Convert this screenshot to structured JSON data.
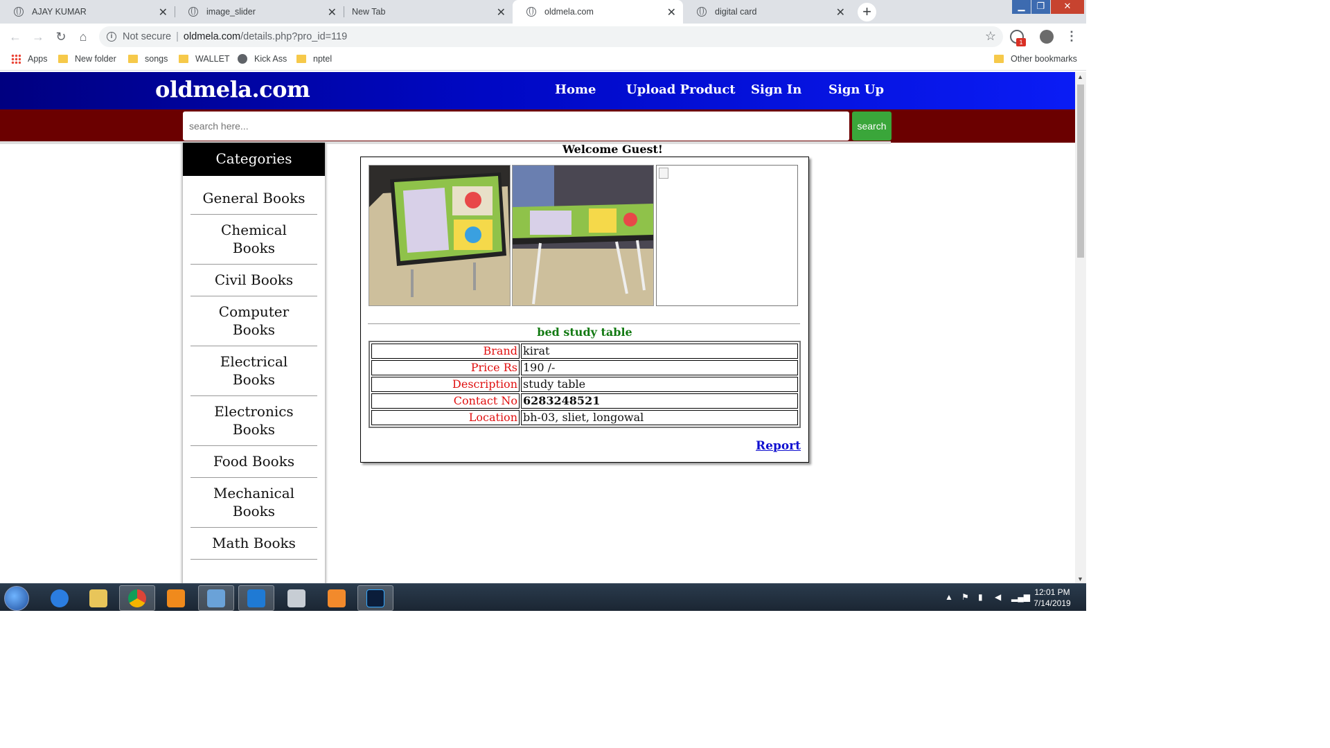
{
  "browser": {
    "tabs": [
      {
        "label": "AJAY KUMAR",
        "active": false
      },
      {
        "label": "image_slider",
        "active": false
      },
      {
        "label": "New Tab",
        "active": false
      },
      {
        "label": "oldmela.com",
        "active": true
      },
      {
        "label": "digital card",
        "active": false
      }
    ],
    "address": {
      "security_label": "Not secure",
      "host": "oldmela.com",
      "path": "/details.php?pro_id=119"
    },
    "extension_badge": "1",
    "bookmarks": [
      {
        "label": "Apps",
        "icon": "apps-grid-icon"
      },
      {
        "label": "New folder",
        "icon": "folder-icon"
      },
      {
        "label": "songs",
        "icon": "folder-icon"
      },
      {
        "label": "WALLET",
        "icon": "folder-icon"
      },
      {
        "label": "Kick Ass",
        "icon": "globe-icon"
      },
      {
        "label": "nptel",
        "icon": "folder-icon"
      }
    ],
    "other_bookmarks": "Other bookmarks"
  },
  "site": {
    "brand": "oldmela.com",
    "nav": [
      "Home",
      "Upload Product",
      "Sign In",
      "Sign Up"
    ],
    "search": {
      "placeholder": "search here...",
      "button": "search"
    },
    "sidebar": {
      "title": "Categories",
      "items": [
        "General Books",
        "Chemical Books",
        "Civil Books",
        "Computer Books",
        "Electrical Books",
        "Electronics Books",
        "Food Books",
        "Mechanical Books",
        "Math Books"
      ]
    },
    "welcome": "Welcome Guest!",
    "product": {
      "title": "bed study table",
      "details": [
        {
          "key": "Brand",
          "value": "kirat"
        },
        {
          "key": "Price Rs",
          "value": "190 /-"
        },
        {
          "key": "Description",
          "value": "study table"
        },
        {
          "key": "Contact No",
          "value": "6283248521"
        },
        {
          "key": "Location",
          "value": "bh-03, sliet, longowal"
        }
      ],
      "report": "Report"
    }
  },
  "taskbar": {
    "time": "12:01 PM",
    "date": "7/14/2019"
  },
  "colors": {
    "header": "#0008c4",
    "search_band": "#6b0000",
    "search_button": "#3aa63a",
    "detail_key": "#e01010",
    "product_title": "#137a13",
    "link": "#1010d0"
  }
}
